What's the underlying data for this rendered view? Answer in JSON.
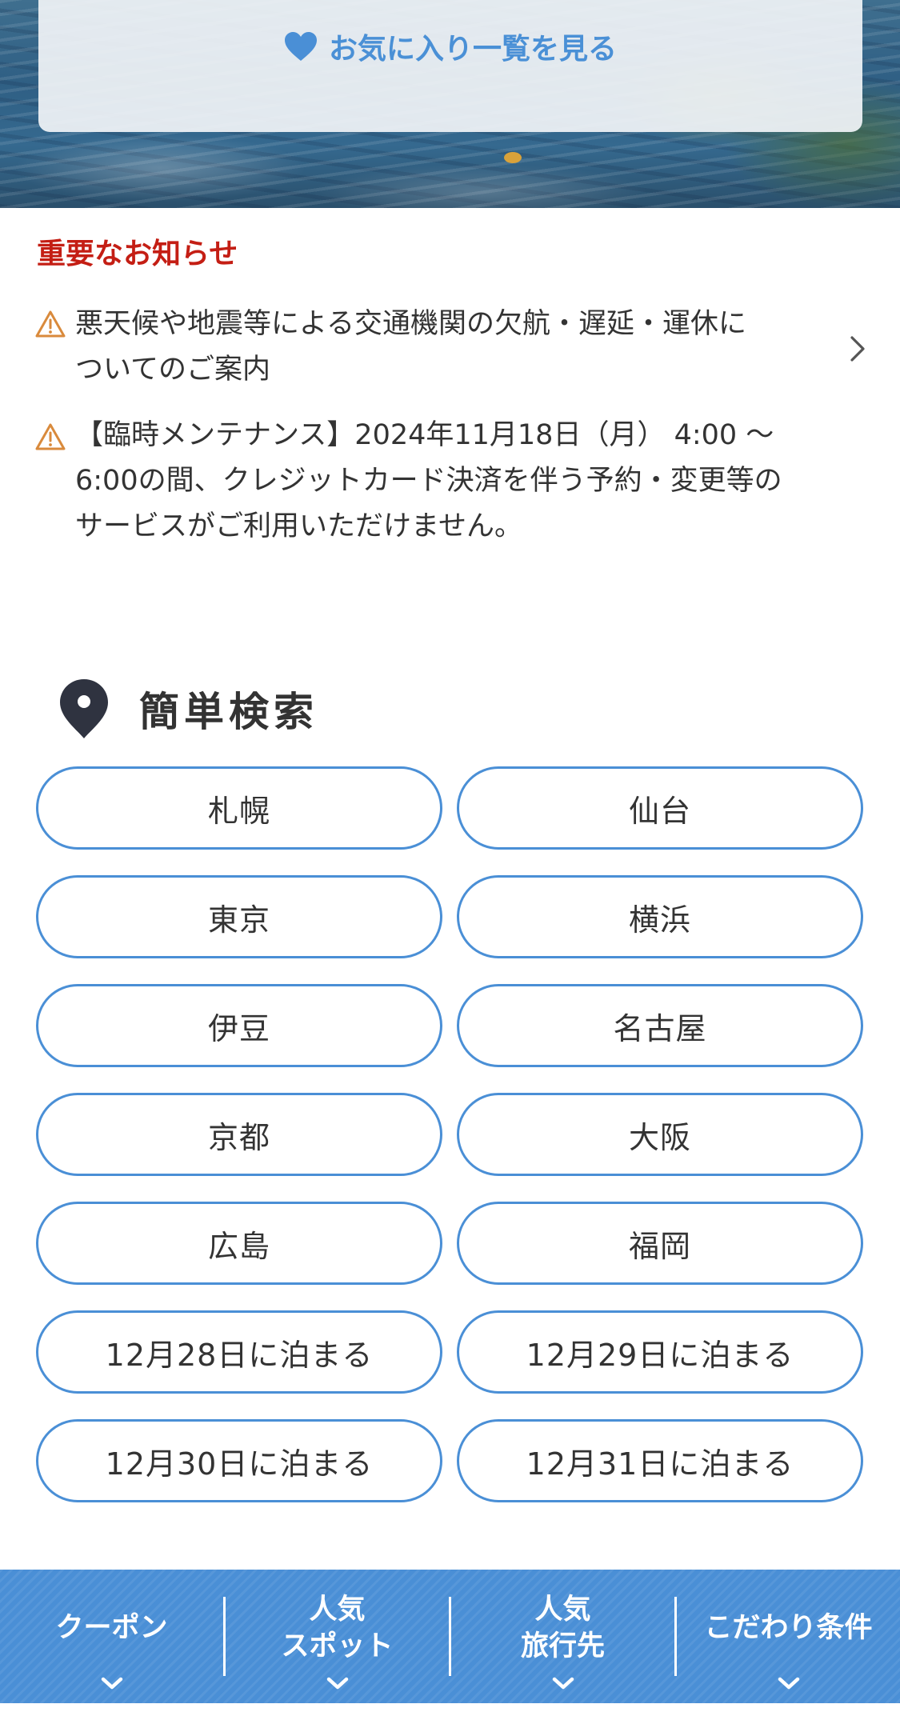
{
  "favorites": {
    "label": "お気に入り一覧を見る"
  },
  "notices": {
    "title": "重要なお知らせ",
    "items": [
      {
        "line1": "悪天候や地震等による交通機関の欠航・遅延・運休に",
        "line2": "ついてのご案内"
      },
      {
        "line1": "【臨時メンテナンス】2024年11月18日（月） 4:00 ～",
        "line2": "6:00の間、クレジットカード決済を伴う予約・変更等の",
        "line3": "サービスがご利用いただけません。"
      }
    ]
  },
  "search": {
    "title": "簡単検索",
    "buttons": [
      "札幌",
      "仙台",
      "東京",
      "横浜",
      "伊豆",
      "名古屋",
      "京都",
      "大阪",
      "広島",
      "福岡",
      "12月28日に泊まる",
      "12月29日に泊まる",
      "12月30日に泊まる",
      "12月31日に泊まる"
    ]
  },
  "tabbar": {
    "tabs": [
      {
        "line1": "クーポン",
        "line2": ""
      },
      {
        "line1": "人気",
        "line2": "スポット"
      },
      {
        "line1": "人気",
        "line2": "旅行先"
      },
      {
        "line1": "こだわり条件",
        "line2": ""
      }
    ]
  },
  "icons": {
    "heart": "heart-icon",
    "warning": "warning-icon",
    "chevron_right": "chevron-right-icon",
    "location_pin": "location-pin-icon",
    "chevron_down": "chevron-down-icon"
  },
  "colors": {
    "accent": "#4a8fd6",
    "notice_title": "#c41e14",
    "warning_icon": "#d98a3c",
    "text": "#333333"
  }
}
